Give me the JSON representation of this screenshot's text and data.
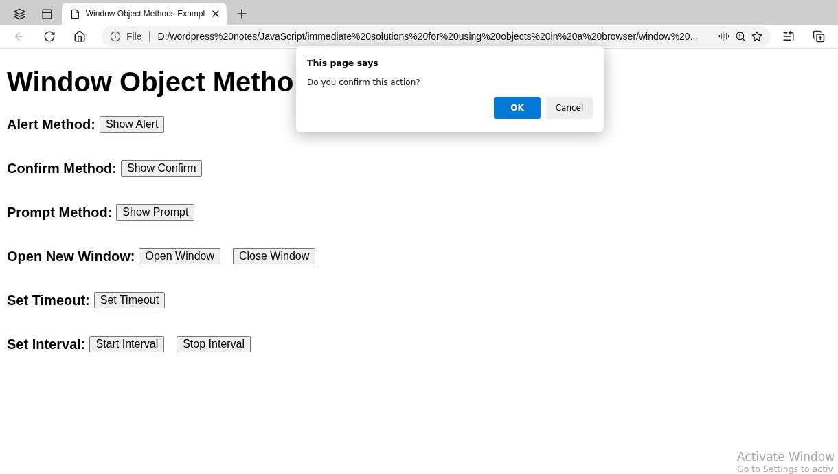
{
  "browser": {
    "tabs": [
      {
        "title": "Window Object Methods Exampl",
        "selected": true
      }
    ],
    "address": {
      "scheme": "File",
      "url": "D:/wordpress%20notes/JavaScript/immediate%20solutions%20for%20using%20objects%20in%20a%20browser/window%20..."
    },
    "back_disabled": true
  },
  "page": {
    "heading": "Window Object Metho",
    "sections": [
      {
        "label": "Alert Method:",
        "buttons": [
          "Show Alert"
        ]
      },
      {
        "label": "Confirm Method:",
        "buttons": [
          "Show Confirm"
        ]
      },
      {
        "label": "Prompt Method:",
        "buttons": [
          "Show Prompt"
        ]
      },
      {
        "label": "Open New Window:",
        "buttons": [
          "Open Window",
          "Close Window"
        ]
      },
      {
        "label": "Set Timeout:",
        "buttons": [
          "Set Timeout"
        ]
      },
      {
        "label": "Set Interval:",
        "buttons": [
          "Start Interval",
          "Stop Interval"
        ]
      }
    ]
  },
  "dialog": {
    "title": "This page says",
    "message": "Do you confirm this action?",
    "buttons": [
      {
        "label": "OK",
        "kind": "primary"
      },
      {
        "label": "Cancel",
        "kind": "secondary"
      }
    ]
  },
  "os_notice": {
    "title": "Activate Window",
    "subtitle": "Go to Settings to activ"
  }
}
